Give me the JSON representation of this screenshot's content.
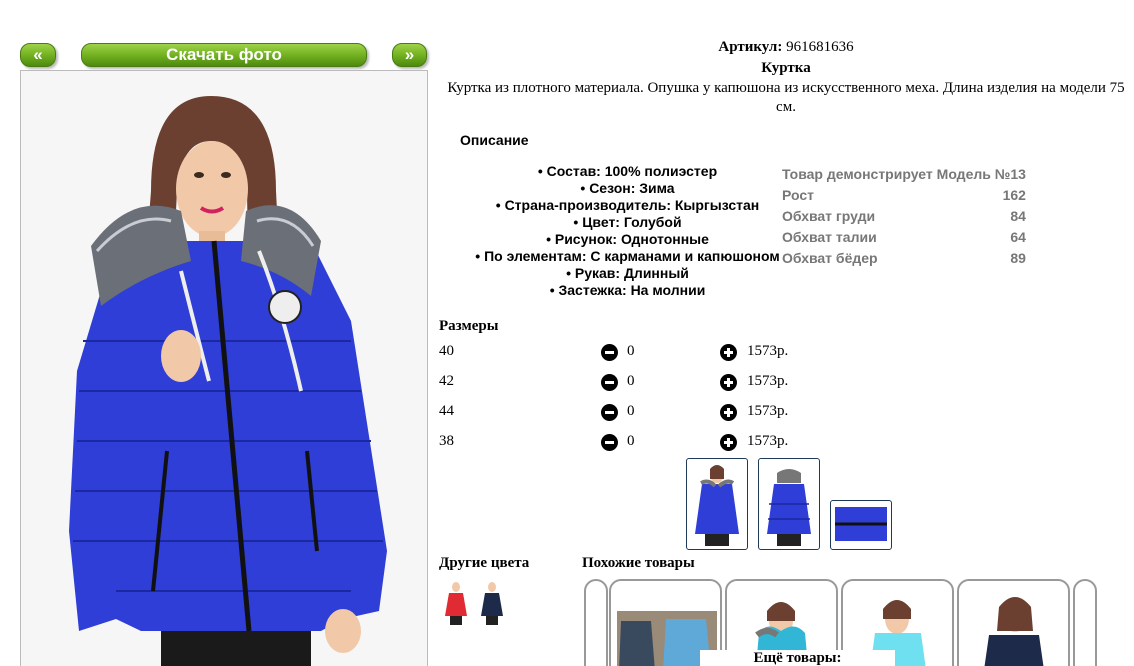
{
  "gallery": {
    "prev_label": "«",
    "download_label": "Скачать фото",
    "next_label": "»"
  },
  "product": {
    "article_label": "Артикул:",
    "article_value": "961681636",
    "name": "Куртка",
    "description": "Куртка из плотного материала. Опушка у капюшона из искусственного меха. Длина изделия на модели 75 см."
  },
  "specs": {
    "heading": "Описание",
    "items": [
      "Состав: 100% полиэстер",
      "Сезон: Зима",
      "Страна-производитель: Кыргызстан",
      "Цвет: Голубой",
      "Рисунок: Однотонные",
      "По элементам: С карманами и капюшоном",
      "Рукав: Длинный",
      "Застежка: На молнии"
    ]
  },
  "model": {
    "title": "Товар демонстрирует Модель №13",
    "rows": [
      {
        "label": "Рост",
        "value": "162"
      },
      {
        "label": "Обхват груди",
        "value": "84"
      },
      {
        "label": "Обхват талии",
        "value": "64"
      },
      {
        "label": "Обхват бёдер",
        "value": "89"
      }
    ]
  },
  "sizes": {
    "heading": "Размеры",
    "rows": [
      {
        "size": "40",
        "qty": "0",
        "price": "1573р."
      },
      {
        "size": "42",
        "qty": "0",
        "price": "1573р."
      },
      {
        "size": "44",
        "qty": "0",
        "price": "1573р."
      },
      {
        "size": "38",
        "qty": "0",
        "price": "1573р."
      }
    ]
  },
  "sections": {
    "other_colors": "Другие цвета",
    "similar": "Похожие товары",
    "more": "Ещё товары:"
  },
  "colors": {
    "jacket_blue": "#2f3ed6",
    "jacket_red": "#e02a34",
    "jacket_navy": "#1e2a4a",
    "button_green": "#6fae1e"
  }
}
